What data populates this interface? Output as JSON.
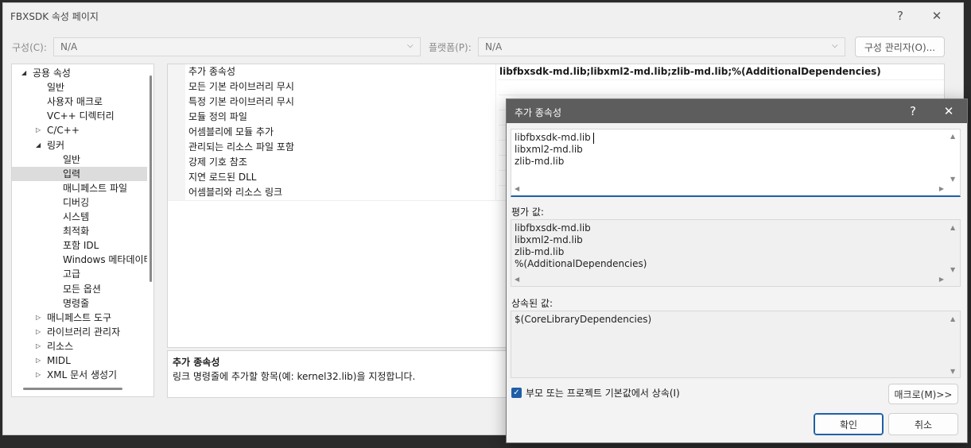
{
  "window": {
    "title": "FBXSDK 속성 페이지",
    "help": "?",
    "close": "✕"
  },
  "toolbar": {
    "config_label": "구성(C):",
    "config_value": "N/A",
    "platform_label": "플랫폼(P):",
    "platform_value": "N/A",
    "config_manager": "구성 관리자(O)..."
  },
  "tree": [
    {
      "label": "공용 속성",
      "arrow": "◢"
    },
    {
      "label": "일반",
      "arrow": ""
    },
    {
      "label": "사용자 매크로",
      "arrow": ""
    },
    {
      "label": "VC++ 디렉터리",
      "arrow": ""
    },
    {
      "label": "C/C++",
      "arrow": "▷"
    },
    {
      "label": "링커",
      "arrow": "◢"
    },
    {
      "label": "일반",
      "arrow": ""
    },
    {
      "label": "입력",
      "arrow": ""
    },
    {
      "label": "매니페스트 파일",
      "arrow": ""
    },
    {
      "label": "디버깅",
      "arrow": ""
    },
    {
      "label": "시스템",
      "arrow": ""
    },
    {
      "label": "최적화",
      "arrow": ""
    },
    {
      "label": "포함 IDL",
      "arrow": ""
    },
    {
      "label": "Windows 메타데이터",
      "arrow": ""
    },
    {
      "label": "고급",
      "arrow": ""
    },
    {
      "label": "모든 옵션",
      "arrow": ""
    },
    {
      "label": "명령줄",
      "arrow": ""
    },
    {
      "label": "매니페스트 도구",
      "arrow": "▷"
    },
    {
      "label": "라이브러리 관리자",
      "arrow": "▷"
    },
    {
      "label": "리소스",
      "arrow": "▷"
    },
    {
      "label": "MIDL",
      "arrow": "▷"
    },
    {
      "label": "XML 문서 생성기",
      "arrow": "▷"
    }
  ],
  "grid": [
    {
      "name": "추가 종속성",
      "value": "libfbxsdk-md.lib;libxml2-md.lib;zlib-md.lib;%(AdditionalDependencies)"
    },
    {
      "name": "모든 기본 라이브러리 무시",
      "value": ""
    },
    {
      "name": "특정 기본 라이브러리 무시",
      "value": ""
    },
    {
      "name": "모듈 정의 파일",
      "value": ""
    },
    {
      "name": "어셈블리에 모듈 추가",
      "value": ""
    },
    {
      "name": "관리되는 리소스 파일 포함",
      "value": ""
    },
    {
      "name": "강제 기호 참조",
      "value": ""
    },
    {
      "name": "지연 로드된 DLL",
      "value": ""
    },
    {
      "name": "어셈블리와 리소스 링크",
      "value": ""
    }
  ],
  "description": {
    "title": "추가 종속성",
    "text": "링크 명령줄에 추가할 항목(예: kernel32.lib)을 지정합니다."
  },
  "dialog": {
    "title": "추가 종속성",
    "help": "?",
    "close": "✕",
    "edit_lines": [
      "libfbxsdk-md.lib",
      "libxml2-md.lib",
      "zlib-md.lib"
    ],
    "evaluated_label": "평가 값:",
    "evaluated_lines": [
      "libfbxsdk-md.lib",
      "libxml2-md.lib",
      "zlib-md.lib",
      "%(AdditionalDependencies)"
    ],
    "inherited_label": "상속된 값:",
    "inherited_lines": [
      "$(CoreLibraryDependencies)"
    ],
    "inherit_checkbox": "부모 또는 프로젝트 기본값에서 상속(I)",
    "inherit_checked": true,
    "macro_button": "매크로(M)>>",
    "ok_button": "확인",
    "cancel_button": "취소"
  },
  "colors": {
    "dialog_title_bg": "#5d5d5d",
    "accent": "#1f5fa6",
    "selection": "#dcdcdc"
  }
}
